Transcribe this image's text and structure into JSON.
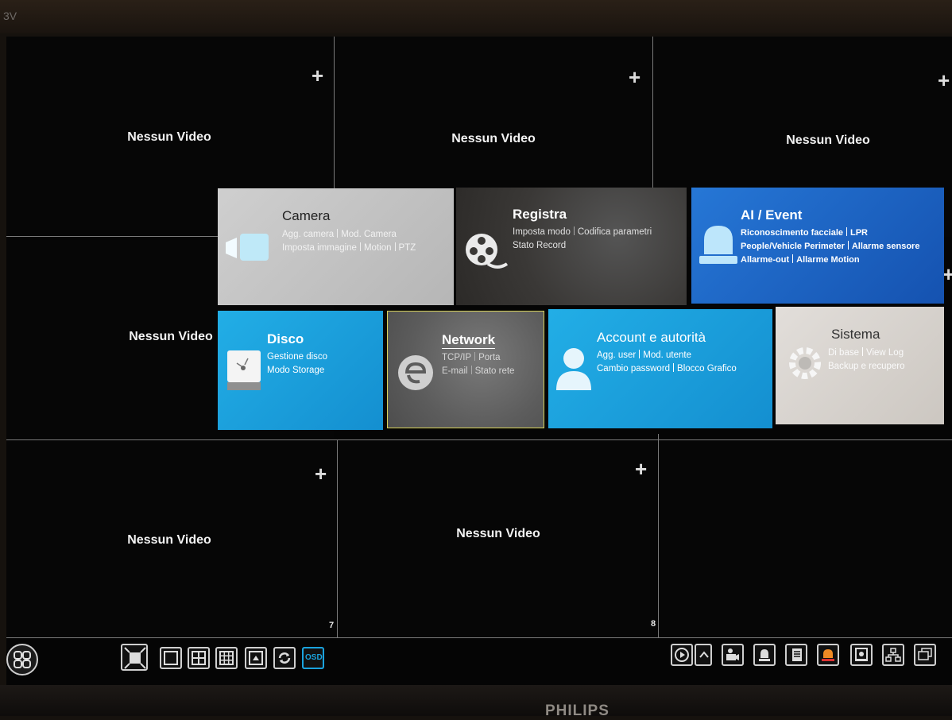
{
  "bezel": {
    "corner_text": "3V",
    "brand": "PHILIPS"
  },
  "grid": {
    "no_video_label": "Nessun Video",
    "channel_numbers": [
      "7",
      "8"
    ]
  },
  "menu": {
    "camera": {
      "title": "Camera",
      "lines": [
        [
          "Agg. camera",
          "Mod. Camera"
        ],
        [
          "Imposta immagine",
          "Motion",
          "PTZ"
        ]
      ],
      "icon": "video-camera-icon",
      "color": "#c2c2c2"
    },
    "registra": {
      "title": "Registra",
      "lines": [
        [
          "Imposta modo",
          "Codifica parametri"
        ],
        [
          "Stato Record"
        ]
      ],
      "icon": "film-reel-icon",
      "color": "#3c3a38"
    },
    "ai_event": {
      "title": "AI / Event",
      "lines": [
        [
          "Riconoscimento facciale",
          "LPR"
        ],
        [
          "People/Vehicle Perimeter",
          "Allarme sensore"
        ],
        [
          "Allarme-out",
          "Allarme Motion"
        ]
      ],
      "icon": "alarm-light-icon",
      "color": "#1b62c4"
    },
    "disco": {
      "title": "Disco",
      "lines": [
        [
          "Gestione disco"
        ],
        [
          "Modo Storage"
        ]
      ],
      "icon": "hard-disk-icon",
      "color": "#1aa3de"
    },
    "network": {
      "title": "Network",
      "lines": [
        [
          "TCP/IP",
          "Porta"
        ],
        [
          "E-mail",
          "Stato rete"
        ]
      ],
      "icon": "internet-e-icon",
      "color": "#5f5f5f"
    },
    "account": {
      "title": "Account e autorità",
      "lines": [
        [
          "Agg. user",
          "Mod. utente"
        ],
        [
          "Cambio password",
          "Blocco Grafico"
        ]
      ],
      "icon": "user-icon",
      "color": "#1aa3de"
    },
    "sistema": {
      "title": "Sistema",
      "lines": [
        [
          "Di base",
          "View Log"
        ],
        [
          "Backup e recupero"
        ]
      ],
      "icon": "gear-icon",
      "color": "#d8d4cf"
    }
  },
  "toolbar": {
    "osd_label": "OSD",
    "left_icons": [
      "start-menu-icon",
      "fullscreen-icon",
      "layout-1-icon",
      "layout-4-icon",
      "layout-9-icon",
      "layout-custom-icon",
      "sequence-icon",
      "osd-icon"
    ],
    "right_icons": [
      "playback-icon",
      "collapse-arrow-icon",
      "ptz-camera-icon",
      "manual-alarm-icon",
      "log-icon",
      "alarm-status-icon",
      "disk-info-icon",
      "network-status-icon",
      "multi-screen-icon"
    ],
    "osd_color": "#1aa3de"
  }
}
